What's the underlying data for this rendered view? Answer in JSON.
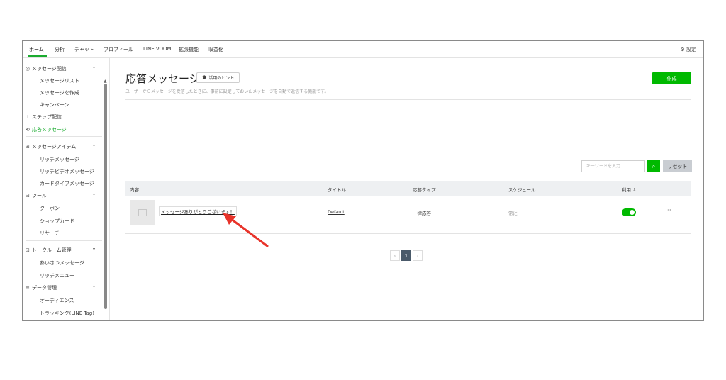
{
  "topnav": {
    "tabs": [
      "ホーム",
      "分析",
      "チャット",
      "プロフィール",
      "LINE VOOM",
      "拡張機能",
      "収益化"
    ],
    "settings_label": "設定"
  },
  "sidebar": {
    "items": [
      {
        "label": "メッセージ配信",
        "icon": "broadcast-icon"
      },
      {
        "label": "メッセージリスト"
      },
      {
        "label": "メッセージを作成"
      },
      {
        "label": "キャンペーン"
      },
      {
        "label": "ステップ配信",
        "icon": "step-icon"
      },
      {
        "label": "応答メッセージ",
        "icon": "auto-reply-icon"
      },
      {
        "label": "メッセージアイテム",
        "icon": "message-item-icon"
      },
      {
        "label": "リッチメッセージ"
      },
      {
        "label": "リッチビデオメッセージ"
      },
      {
        "label": "カードタイプメッセージ"
      },
      {
        "label": "ツール",
        "icon": "tool-icon"
      },
      {
        "label": "クーポン"
      },
      {
        "label": "ショップカード"
      },
      {
        "label": "リサーチ"
      },
      {
        "label": "トークルーム管理",
        "icon": "chatroom-icon"
      },
      {
        "label": "あいさつメッセージ"
      },
      {
        "label": "リッチメニュー"
      },
      {
        "label": "データ管理",
        "icon": "database-icon"
      },
      {
        "label": "オーディエンス"
      },
      {
        "label": "トラッキング(LINE Tag)"
      }
    ]
  },
  "main": {
    "title": "応答メッセージ",
    "hint_label": "活用のヒント",
    "description": "ユーザーからメッセージを受信したときに、事前に設定しておいたメッセージを自動で返信する機能です。",
    "create_label": "作成",
    "search_placeholder": "キーワードを入力",
    "reset_label": "リセット",
    "columns": [
      "内容",
      "タイトル",
      "応答タイプ",
      "スケジュール",
      "利用"
    ],
    "rows": [
      {
        "content": "メッセージありがとうございます！",
        "content_sub": "...",
        "title": "Default",
        "type": "一律応答",
        "schedule": "常に",
        "enabled": true
      }
    ],
    "pagination": {
      "current": "1"
    }
  },
  "colors": {
    "accent": "#00b900",
    "annotation_arrow": "#e8332a"
  }
}
